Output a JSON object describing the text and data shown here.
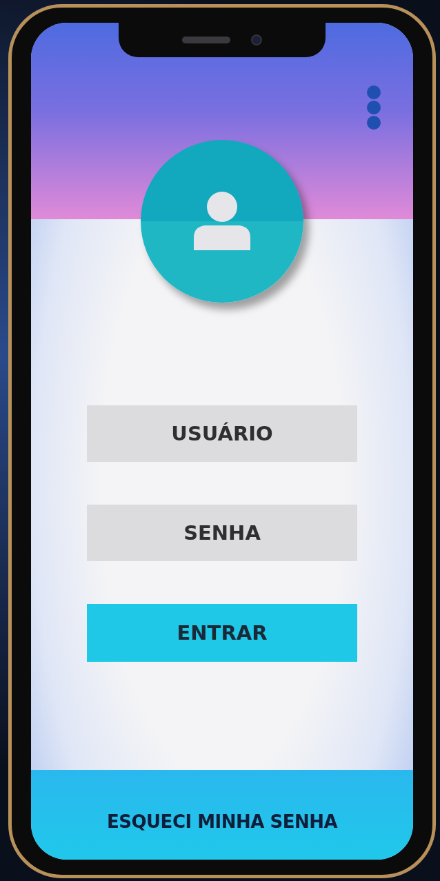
{
  "login": {
    "fields": [
      {
        "placeholder": "USUÁRIO"
      },
      {
        "placeholder": "SENHA"
      }
    ],
    "submit": "ENTRAR"
  },
  "footer": {
    "link": "ESQUECI MINHA SENHA"
  }
}
